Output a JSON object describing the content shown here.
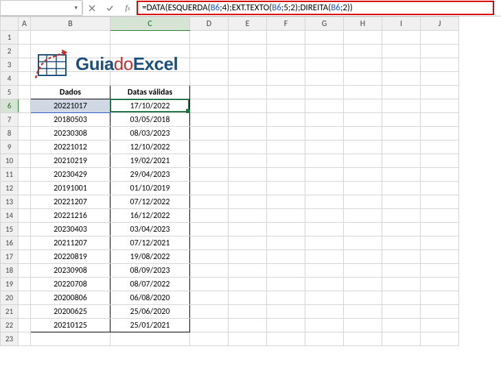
{
  "name_box": "",
  "formula": {
    "raw": "=DATA(ESQUERDA(B6;4);EXT.TEXTO(B6;5;2);DIREITA(B6;2))",
    "parts": [
      {
        "t": "=",
        "c": "fn"
      },
      {
        "t": "DATA",
        "c": "fn"
      },
      {
        "t": "(",
        "c": "paren-a"
      },
      {
        "t": "ESQUERDA",
        "c": "fn"
      },
      {
        "t": "(",
        "c": "paren-b"
      },
      {
        "t": "B6",
        "c": "ref"
      },
      {
        "t": ";4",
        "c": "fn"
      },
      {
        "t": ")",
        "c": "paren-b"
      },
      {
        "t": ";",
        "c": "fn"
      },
      {
        "t": "EXT.TEXTO",
        "c": "fn"
      },
      {
        "t": "(",
        "c": "paren-b"
      },
      {
        "t": "B6",
        "c": "ref"
      },
      {
        "t": ";5;2",
        "c": "fn"
      },
      {
        "t": ")",
        "c": "paren-b"
      },
      {
        "t": ";",
        "c": "fn"
      },
      {
        "t": "DIREITA",
        "c": "fn"
      },
      {
        "t": "(",
        "c": "paren-b"
      },
      {
        "t": "B6",
        "c": "ref"
      },
      {
        "t": ";2",
        "c": "fn"
      },
      {
        "t": ")",
        "c": "paren-b"
      },
      {
        "t": ")",
        "c": "paren-a"
      }
    ]
  },
  "columns": [
    "A",
    "B",
    "C",
    "D",
    "E",
    "F",
    "G",
    "H",
    "I",
    "J"
  ],
  "headers": {
    "B": "Dados",
    "C": "Datas válidas"
  },
  "logo": {
    "part1": "Guia",
    "part2": "do",
    "part3": "Excel"
  },
  "rows": [
    {
      "n": 1
    },
    {
      "n": 2
    },
    {
      "n": 3
    },
    {
      "n": 4
    },
    {
      "n": 5,
      "B": "Dados",
      "C": "Datas válidas",
      "header": true
    },
    {
      "n": 6,
      "B": "20221017",
      "C": "17/10/2022",
      "active": true
    },
    {
      "n": 7,
      "B": "20180503",
      "C": "03/05/2018"
    },
    {
      "n": 8,
      "B": "20230308",
      "C": "08/03/2023"
    },
    {
      "n": 9,
      "B": "20221012",
      "C": "12/10/2022"
    },
    {
      "n": 10,
      "B": "20210219",
      "C": "19/02/2021"
    },
    {
      "n": 11,
      "B": "20230429",
      "C": "29/04/2023"
    },
    {
      "n": 12,
      "B": "20191001",
      "C": "01/10/2019"
    },
    {
      "n": 13,
      "B": "20221207",
      "C": "07/12/2022"
    },
    {
      "n": 14,
      "B": "20221216",
      "C": "16/12/2022"
    },
    {
      "n": 15,
      "B": "20230403",
      "C": "03/04/2023"
    },
    {
      "n": 16,
      "B": "20211207",
      "C": "07/12/2021"
    },
    {
      "n": 17,
      "B": "20220819",
      "C": "19/08/2022"
    },
    {
      "n": 18,
      "B": "20230908",
      "C": "08/09/2023"
    },
    {
      "n": 19,
      "B": "20220708",
      "C": "08/07/2022"
    },
    {
      "n": 20,
      "B": "20200806",
      "C": "06/08/2020"
    },
    {
      "n": 21,
      "B": "20200625",
      "C": "25/06/2020"
    },
    {
      "n": 22,
      "B": "20210125",
      "C": "25/01/2021",
      "last": true
    },
    {
      "n": 23
    }
  ],
  "active_cell": "C6",
  "selected_col": "C",
  "selected_row": 6
}
